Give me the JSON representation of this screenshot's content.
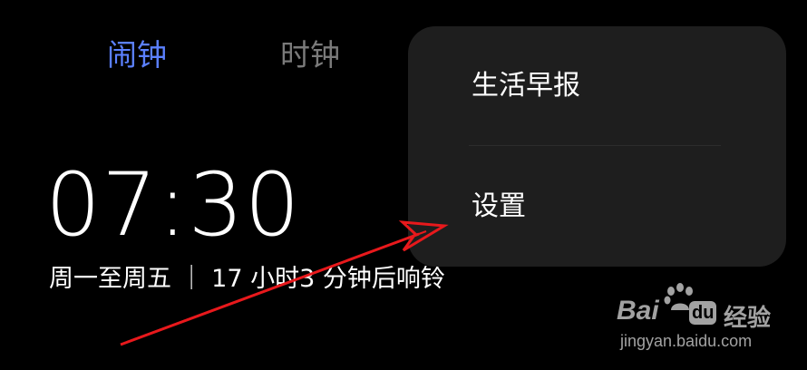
{
  "tabs": [
    {
      "label": "闹钟",
      "active": true
    },
    {
      "label": "时钟",
      "active": false
    }
  ],
  "alarm": {
    "time": "07:30",
    "description": "周一至周五 ｜ 17 小时3 分钟后响铃"
  },
  "menu": {
    "items": [
      {
        "label": "生活早报"
      },
      {
        "label": "设置"
      }
    ]
  },
  "watermark": {
    "brand_left": "Bai",
    "brand_du": "du",
    "brand_right": "经验",
    "url": "jingyan.baidu.com"
  },
  "colors": {
    "background": "#000000",
    "active_tab": "#5b80ff",
    "inactive_tab": "#7a7a7a",
    "menu_background": "#1e1e1e",
    "annotation_arrow": "#e8191c"
  },
  "icons": [
    "paw-logo-icon",
    "annotation-arrow"
  ]
}
